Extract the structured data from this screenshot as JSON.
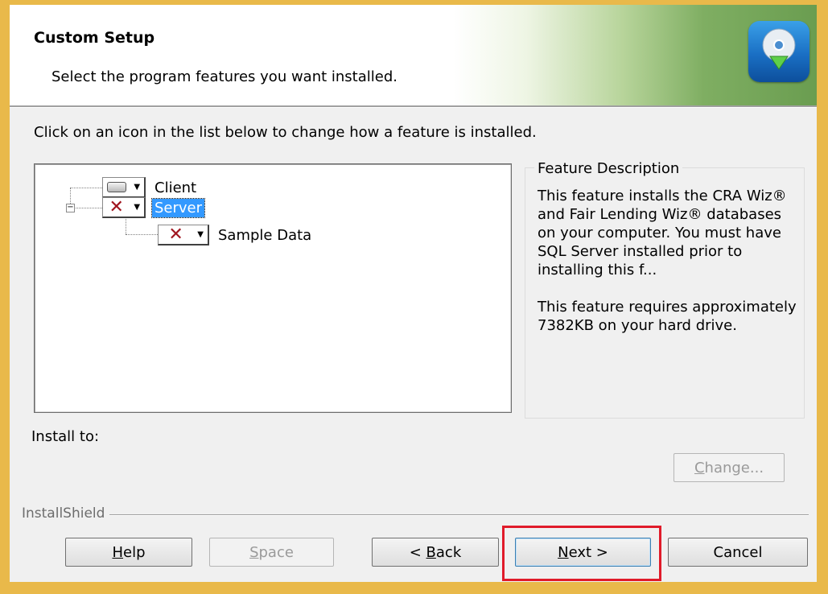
{
  "header": {
    "title": "Custom Setup",
    "subtitle": "Select the program features you want installed."
  },
  "instruction": "Click on an icon in the list below to change how a feature is installed.",
  "tree": {
    "items": [
      {
        "label": "Client",
        "icon": "hard-drive-icon",
        "selected": false
      },
      {
        "label": "Server",
        "icon": "x-unavailable-icon",
        "selected": true
      },
      {
        "label": "Sample Data",
        "icon": "x-unavailable-icon",
        "selected": false
      }
    ]
  },
  "description": {
    "legend": "Feature Description",
    "paragraph1": "This feature installs the CRA Wiz® and Fair Lending Wiz® databases on your computer. You must have SQL Server installed prior to installing this f...",
    "paragraph2": "This feature requires approximately 7382KB on your hard drive."
  },
  "install_to": {
    "label": "Install to:",
    "change_label": "Change..."
  },
  "footer": {
    "brand": "InstallShield"
  },
  "buttons": {
    "help": "Help",
    "space": "Space",
    "back": "< Back",
    "next": "Next >",
    "cancel": "Cancel"
  },
  "colors": {
    "selection": "#3399ff",
    "x_icon": "#a0141e",
    "highlight_box": "#e01b2a"
  }
}
